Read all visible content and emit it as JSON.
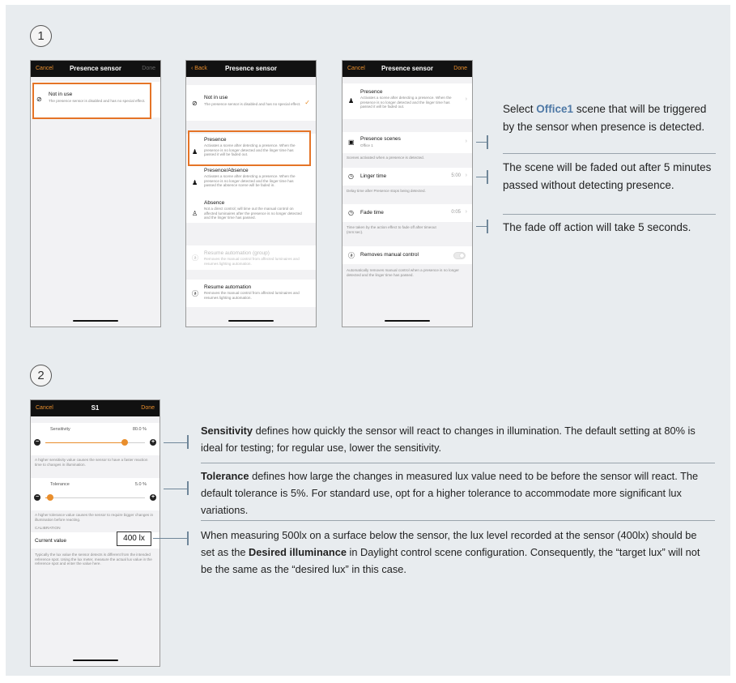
{
  "steps": [
    "1",
    "2"
  ],
  "phone1": {
    "nav": {
      "left": "Cancel",
      "title": "Presence sensor",
      "right": "Done"
    },
    "item": {
      "title": "Not in use",
      "desc": "The presence sensor is disabled and has no special effect."
    }
  },
  "phone2": {
    "nav": {
      "left": "Back",
      "title": "Presence sensor"
    },
    "not_in_use": {
      "title": "Not in use",
      "desc": "The presence sensor is disabled and has no special effect."
    },
    "presence": {
      "title": "Presence",
      "desc": "Activates a scene after detecting a presence. When the presence is no longer detected and the linger time has passed it will be faded out."
    },
    "presence_absence": {
      "title": "Presence/Absence",
      "desc": "Activates a scene after detecting a presence. When the presence is no longer detected and the linger time has passed the absence scene will be faded in."
    },
    "absence": {
      "title": "Absence",
      "desc": "Not a direct control; will time out the manual control on affected luminaires after the presence is no longer detected and the linger time has passed."
    },
    "resume_group": {
      "title": "Resume automation (group)",
      "desc": "Removes the manual control from affected luminaires and resumes lighting automation."
    },
    "resume": {
      "title": "Resume automation",
      "desc": "Removes the manual control from affected luminaires and resumes lighting automation."
    }
  },
  "phone3": {
    "nav": {
      "left": "Cancel",
      "title": "Presence sensor",
      "right": "Done"
    },
    "presence": {
      "title": "Presence",
      "desc": "Activates a scene after detecting a presence. When the presence is no longer detected and the linger time has passed it will be faded out."
    },
    "scenes": {
      "title": "Presence scenes",
      "sub": "Office 1",
      "note": "Scenes activated when a presence is detected."
    },
    "linger": {
      "title": "Linger time",
      "value": "5:00",
      "note": "Delay time after Presence stops being detected."
    },
    "fade": {
      "title": "Fade time",
      "value": "0:05",
      "note": "Time taken by the action effect to fade off after timeout (mm:sec)."
    },
    "manual": {
      "title": "Removes manual control",
      "note": "Automatically removes manual control when a presence is no longer detected and the linger time has passed."
    }
  },
  "callouts1": {
    "scene_pre": "Select ",
    "scene_bold": "Office1",
    "scene_post": " scene that will be triggered by the sensor when presence is detected.",
    "linger": "The scene will be faded out after 5 minutes passed without detecting presence.",
    "fade": "The fade off action will take 5 seconds."
  },
  "phone4": {
    "nav": {
      "left": "Cancel",
      "title": "S1",
      "right": "Done"
    },
    "sensitivity": {
      "label": "Sensitivity",
      "value": "80.0 %",
      "level": 0.8,
      "note": "A higher sensitivity value causes the sensor to have a faster reaction time to changes in illumination."
    },
    "tolerance": {
      "label": "Tolerance",
      "value": "5.0 %",
      "level": 0.05,
      "note": "A higher tolerance value causes the sensor to require bigger changes in illumination before reacting."
    },
    "calibration": {
      "header": "CALIBRATION",
      "label": "Current value",
      "value": "400 lx",
      "note": "Typically the lux value the sensor detects is different from the intended reference spot. Using the lux meter, measure the actual lux value in the reference spot and enter the value here."
    }
  },
  "callouts2": {
    "sens_bold": "Sensitivity",
    "sens_text": " defines how quickly the sensor will react to changes in illumination. The default setting at 80% is ideal for testing; for regular use, lower the sensitivity.",
    "tol_bold": "Tolerance",
    "tol_text": " defines how large the changes in measured lux value need to be before the sensor will react. The default tolerance is 5%. For standard use, opt for a higher tolerance to accommodate more significant lux variations.",
    "lux_pre": "When measuring 500lx on a surface below the sensor, the lux level recorded at the sensor (400lx) should be set as the ",
    "lux_bold": "Desired illuminance",
    "lux_post": " in Daylight control scene configuration. Consequently, the “target lux” will not be the same as the “desired lux” in this case."
  }
}
